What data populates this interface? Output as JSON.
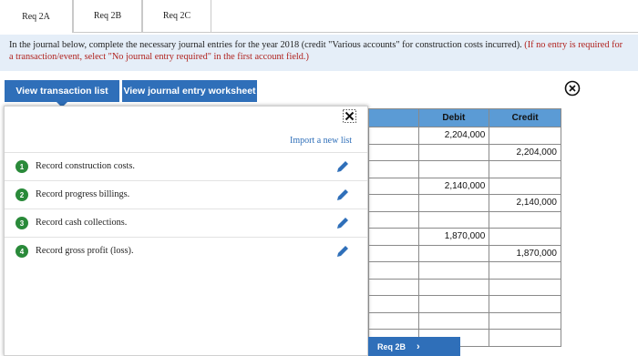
{
  "tabs": [
    "Req 2A",
    "Req 2B",
    "Req 2C"
  ],
  "instructions": {
    "main": "In the journal below, complete the necessary journal entries for the year 2018 (credit \"Various accounts\" for construction costs incurred).",
    "note": "(If no entry is required for a transaction/event, select \"No journal entry required\" in the first account field.)"
  },
  "buttons": {
    "view_transaction_list": "View transaction list",
    "view_journal_entry_worksheet": "View journal entry worksheet"
  },
  "import_link": "Import a new list",
  "items": [
    {
      "num": "1",
      "label": "Record construction costs."
    },
    {
      "num": "2",
      "label": "Record progress billings."
    },
    {
      "num": "3",
      "label": "Record cash collections."
    },
    {
      "num": "4",
      "label": "Record gross profit (loss)."
    }
  ],
  "table": {
    "headers": [
      "",
      "Debit",
      "Credit"
    ],
    "rows": [
      [
        "",
        "2,204,000",
        ""
      ],
      [
        "",
        "",
        "2,204,000"
      ],
      [
        "",
        "",
        ""
      ],
      [
        "",
        "2,140,000",
        ""
      ],
      [
        "",
        "",
        "2,140,000"
      ],
      [
        "",
        "",
        ""
      ],
      [
        "",
        "1,870,000",
        ""
      ],
      [
        "",
        "",
        "1,870,000"
      ],
      [
        "",
        "",
        ""
      ],
      [
        "",
        "",
        ""
      ],
      [
        "",
        "",
        ""
      ],
      [
        "",
        "",
        ""
      ],
      [
        "",
        "",
        ""
      ]
    ]
  },
  "nav": {
    "next_label": "Req 2B",
    "chevron": "›"
  },
  "icons": {
    "close": "close-circle-icon",
    "x": "x-icon",
    "edit": "pencil-icon"
  },
  "colors": {
    "accent": "#2f6fb9",
    "header": "#5b9bd5",
    "step": "#2a8a3a",
    "note": "#b0221e"
  }
}
